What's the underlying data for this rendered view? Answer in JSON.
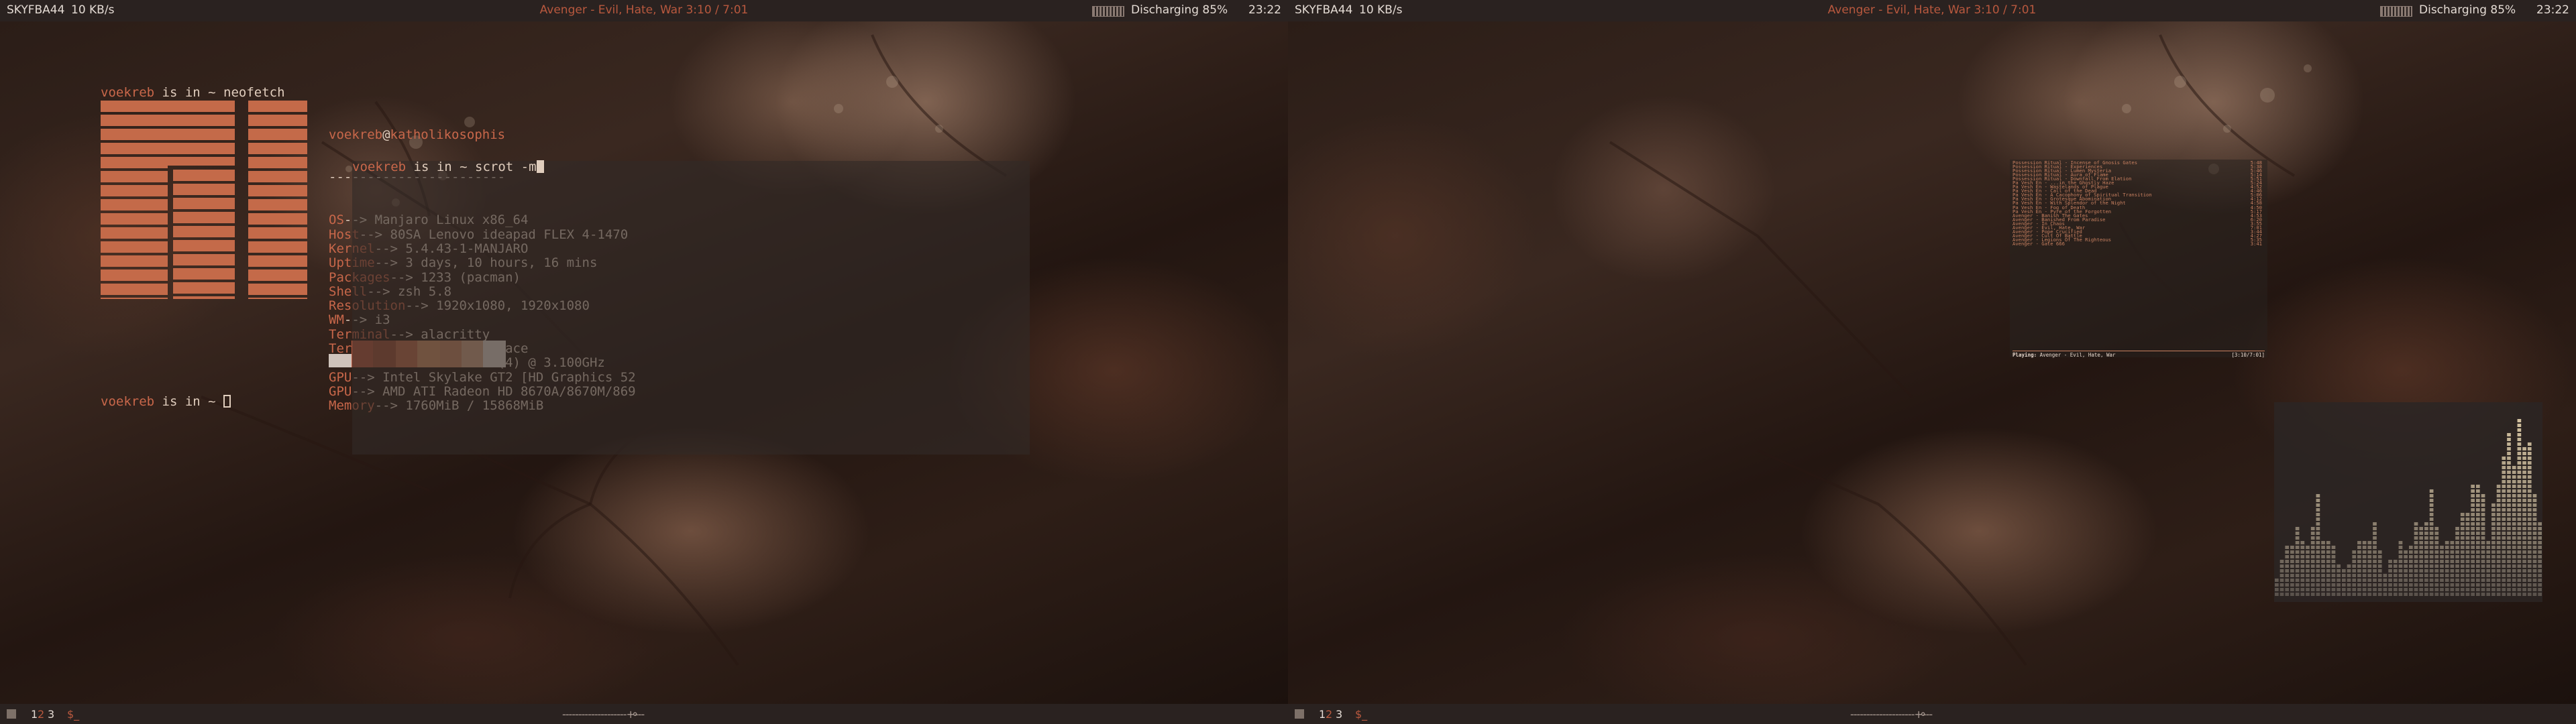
{
  "topbar": {
    "hostname": "SKYFBA44",
    "net_speed": "10 KB/s",
    "now_playing": "Avenger - Evil, Hate, War 3:10 / 7:01",
    "battery_text": "Discharging 85%",
    "time": "23:22"
  },
  "bottombar": {
    "workspaces": [
      "1",
      "2",
      "3"
    ],
    "active_workspace": "1",
    "prompt_glyph": "$_",
    "volume_slider": "--------------------+---",
    "volume_icon": "volume-icon"
  },
  "neofetch_terminal": {
    "prompt_user": "voekreb",
    "prompt_rest": " is in ~ neofetch",
    "header_user": "voekreb",
    "header_at": "@",
    "header_host": "katholikosophis",
    "separator": "-----------------------",
    "info": [
      {
        "key": "OS",
        "arrow": "--> ",
        "value": "Manjaro Linux x86_64"
      },
      {
        "key": "Host",
        "arrow": "--> ",
        "value": "80SA Lenovo ideapad FLEX 4-1470"
      },
      {
        "key": "Kernel",
        "arrow": "--> ",
        "value": "5.4.43-1-MANJARO"
      },
      {
        "key": "Uptime",
        "arrow": "--> ",
        "value": "3 days, 10 hours, 16 mins"
      },
      {
        "key": "Packages",
        "arrow": "--> ",
        "value": "1233 (pacman)"
      },
      {
        "key": "Shell",
        "arrow": "--> ",
        "value": "zsh 5.8"
      },
      {
        "key": "Resolution",
        "arrow": "--> ",
        "value": "1920x1080, 1920x1080"
      },
      {
        "key": "WM",
        "arrow": "--> ",
        "value": "i3"
      },
      {
        "key": "Terminal",
        "arrow": "--> ",
        "value": "alacritty"
      },
      {
        "key": "Terminal Font",
        "arrow": "--> ",
        "value": "monospace"
      },
      {
        "key": "CPU",
        "arrow": "--> ",
        "value": "Intel i7-6500U (4) @ 3.100GHz"
      },
      {
        "key": "GPU",
        "arrow": "--> ",
        "value": "Intel Skylake GT2 [HD Graphics 52"
      },
      {
        "key": "GPU",
        "arrow": "--> ",
        "value": "AMD ATI Radeon HD 8670A/8670M/869"
      },
      {
        "key": "Memory",
        "arrow": "--> ",
        "value": "1760MiB / 15868MiB"
      }
    ],
    "palette": [
      "#cfc3bb",
      "#b9593f",
      "#a4553c",
      "#c36f4e",
      "#d69467",
      "#cc8b68",
      "#d8a88a",
      "#e8d9d0"
    ],
    "bottom_prompt_user": "voekreb",
    "bottom_prompt_rest": " is in ~ "
  },
  "scrot_terminal": {
    "prompt_user": "voekreb",
    "prompt_rest": " is in ~ scrot -m"
  },
  "music_window": {
    "playlist": [
      {
        "title": "Possession Ritual - Incense of Gnosis Gates",
        "length": "5:48"
      },
      {
        "title": "Possession Ritual - Experiences",
        "length": "5:38"
      },
      {
        "title": "Possession Ritual - Lumen Mysteria",
        "length": "5:46"
      },
      {
        "title": "Possession Ritual - Aura of Flame",
        "length": "5:14"
      },
      {
        "title": "Possession Ritual - Downfall From Elation",
        "length": "5:51"
      },
      {
        "title": "Pa Vesh En - ...in the Ghostly Haze",
        "length": "5:24"
      },
      {
        "title": "Pa Vesh En - Wastelands of Plague",
        "length": "4:52"
      },
      {
        "title": "Pa Vesh En - Call of the Dead",
        "length": "4:46"
      },
      {
        "title": "Pa Vesh En - A Cacophony of Spiritual Transition",
        "length": "5:06"
      },
      {
        "title": "Pa Vesh En - Grotesque Abomination",
        "length": "4:12"
      },
      {
        "title": "Pa Vesh En - With Splendor of the Night",
        "length": "4:58"
      },
      {
        "title": "Pa Vesh En - Fog of Death",
        "length": "4:50"
      },
      {
        "title": "Pa Vesh En - Pyre of the Forgotten",
        "length": "5:17"
      },
      {
        "title": "Avenger - Banish The Gates",
        "length": "4:53"
      },
      {
        "title": "Avenger - Banished From Paradise",
        "length": "6:20"
      },
      {
        "title": "Avenger - In Chaos",
        "length": "3:55"
      },
      {
        "title": "Avenger - Evil, Hate, War",
        "length": "7:01"
      },
      {
        "title": "Avenger - Pope Crucified",
        "length": "3:44"
      },
      {
        "title": "Avenger - Cult Of Battle",
        "length": "4:27"
      },
      {
        "title": "Avenger - Legions Of The Righteous",
        "length": "5:35"
      },
      {
        "title": "Avenger - Gate 666",
        "length": "3:41"
      }
    ],
    "status_label": "Playing:",
    "status_track": " Avenger - Evil, Hate, War",
    "status_time": "[3:10/7:01]"
  },
  "visualizer": {
    "levels": [
      0.12,
      0.2,
      0.28,
      0.28,
      0.38,
      0.32,
      0.28,
      0.38,
      0.55,
      0.32,
      0.3,
      0.28,
      0.18,
      0.15,
      0.18,
      0.26,
      0.3,
      0.3,
      0.32,
      0.42,
      0.25,
      0.14,
      0.2,
      0.22,
      0.32,
      0.27,
      0.29,
      0.42,
      0.38,
      0.42,
      0.58,
      0.38,
      0.28,
      0.3,
      0.3,
      0.38,
      0.47,
      0.47,
      0.6,
      0.62,
      0.55,
      0.32,
      0.5,
      0.62,
      0.76,
      0.88,
      0.7,
      0.96,
      0.8,
      0.83,
      0.57,
      0.4
    ]
  }
}
